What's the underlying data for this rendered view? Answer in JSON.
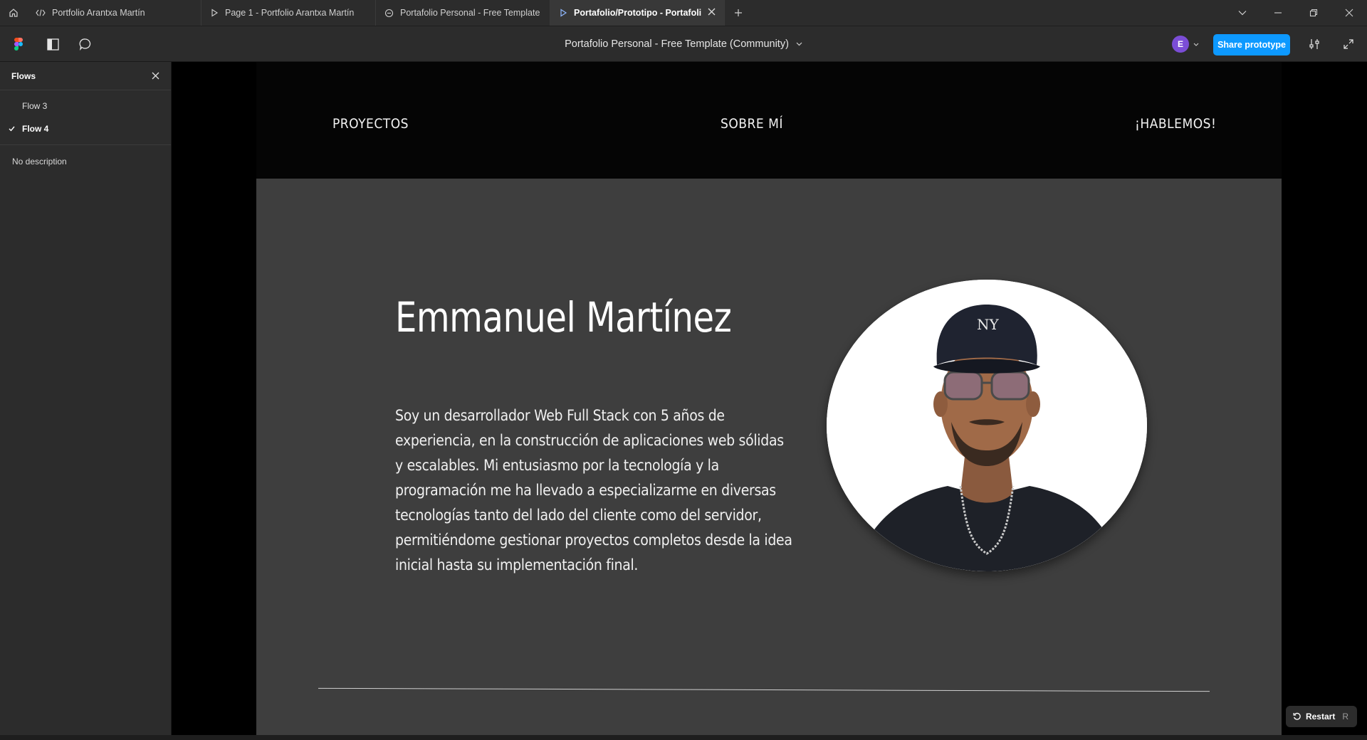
{
  "browser": {
    "tabs": [
      {
        "label": "Portfolio Arantxa Martín",
        "icon": "code-icon",
        "active": false
      },
      {
        "label": "Page 1 - Portfolio Arantxa Martín",
        "icon": "play-icon",
        "active": false
      },
      {
        "label": "Portafolio Personal - Free Template (C",
        "icon": "community-icon",
        "active": false
      },
      {
        "label": "Portafolio/Prototipo - Portafolio P",
        "icon": "play-icon",
        "active": true
      }
    ]
  },
  "toolbar": {
    "document_title": "Portafolio Personal - Free Template (Community)",
    "avatar_initial": "E",
    "share_label": "Share prototype"
  },
  "flows_panel": {
    "title": "Flows",
    "flows": [
      {
        "label": "Flow 3",
        "selected": false
      },
      {
        "label": "Flow 4",
        "selected": true
      }
    ],
    "description": "No description"
  },
  "prototype": {
    "nav": {
      "projects": "PROYECTOS",
      "about": "SOBRE MÍ",
      "contact": "¡HABLEMOS!"
    },
    "hero": {
      "name": "Emmanuel Martínez",
      "bio": "Soy un desarrollador Web Full Stack con 5 años de experiencia, en la construcción de aplicaciones web sólidas y escalables. Mi entusiasmo por la tecnología y la programación me ha llevado a especializarme en diversas tecnologías tanto del lado del cliente como del servidor, permitiéndome gestionar proyectos completos desde la idea inicial hasta su implementación final."
    }
  },
  "restart": {
    "label": "Restart",
    "shortcut": "R"
  },
  "colors": {
    "accent": "#0d99ff",
    "avatar": "#7b4dd6",
    "frame_bg": "#3e3e3e",
    "nav_bg": "#050505"
  }
}
